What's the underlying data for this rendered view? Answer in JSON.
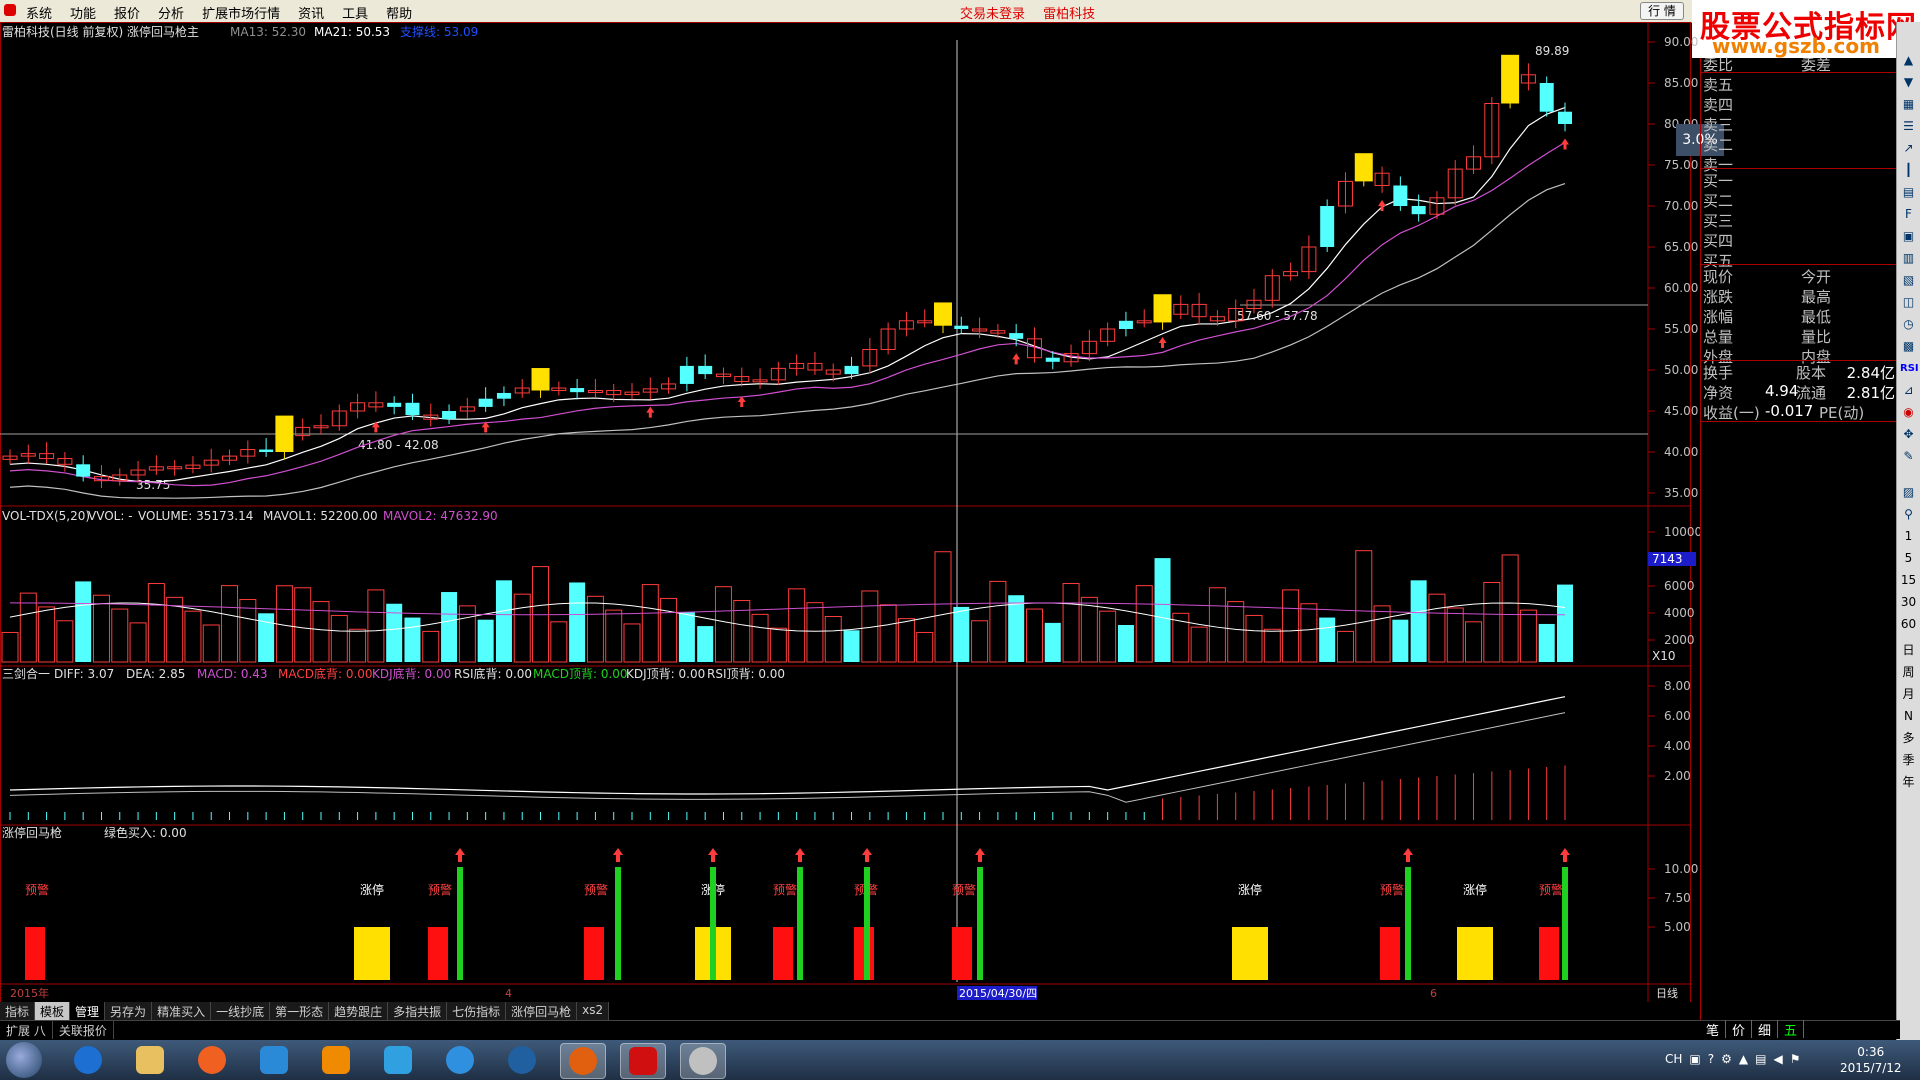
{
  "menubar": {
    "items": [
      "系统",
      "功能",
      "报价",
      "分析",
      "扩展市场行情",
      "资讯",
      "工具",
      "帮助"
    ],
    "status_login": "交易未登录",
    "status_company": "雷柏科技",
    "hangqing": "行 情"
  },
  "watermark": {
    "title": "股票公式指标网",
    "url": "www.gszb.com"
  },
  "main_chart": {
    "title": "雷柏科技(日线 前复权) 涨停回马枪主",
    "ma13": "MA13: 52.30",
    "ma21": "MA21: 50.53",
    "signal": "支撑线: 53.09",
    "high_label": "89.89",
    "low_label": "35.75",
    "range1": "41.80 - 42.08",
    "range2": "57.60 - 57.78",
    "y_ticks": [
      "90.00",
      "85.00",
      "80.00",
      "75.00",
      "70.00",
      "65.00",
      "60.00",
      "55.00",
      "50.00",
      "45.00",
      "40.00",
      "35.00"
    ]
  },
  "vol_panel": {
    "title": "VOL-TDX(5,20)",
    "vvol": "VVOL: -",
    "volume": "VOLUME: 35173.14",
    "mavol1": "MAVOL1: 52200.00",
    "mavol2": "MAVOL2: 47632.90",
    "marker": "7143",
    "unit": "X10",
    "y_ticks": [
      "10000",
      "8000",
      "6000",
      "4000",
      "2000"
    ]
  },
  "macd_panel": {
    "title": "三剑合一",
    "diff": "DIFF: 3.07",
    "dea": "DEA: 2.85",
    "macd": "MACD: 0.43",
    "macd_bottom": "MACD底背: 0.00",
    "kdj_bottom": "KDJ底背: 0.00",
    "rsi_bottom": "RSI底背: 0.00",
    "macd_top": "MACD顶背: 0.00",
    "kdj_top": "KDJ顶背: 0.00",
    "rsi_top": "RSI顶背: 0.00",
    "y_ticks": [
      "8.00",
      "6.00",
      "4.00",
      "2.00"
    ]
  },
  "signal_panel": {
    "title": "涨停回马枪",
    "green_buy": "绿色买入: 0.00",
    "label_warn": "预警",
    "label_limit": "涨停",
    "y_ticks": [
      "10.00",
      "7.50",
      "5.00"
    ]
  },
  "xaxis": {
    "year": "2015年",
    "m4": "4",
    "date": "2015/04/30/四",
    "m6": "6",
    "period": "日线"
  },
  "quote_panel": {
    "sell_rows": [
      {
        "label": "委比",
        "mid": "委差"
      },
      {
        "label": "卖五"
      },
      {
        "label": "卖四"
      },
      {
        "label": "卖三"
      },
      {
        "label": "卖二"
      },
      {
        "label": "卖一"
      }
    ],
    "buy_rows": [
      "买一",
      "买二",
      "买三",
      "买四",
      "买五"
    ],
    "stats": [
      {
        "l": "现价",
        "m": "今开"
      },
      {
        "l": "涨跌",
        "m": "最高"
      },
      {
        "l": "涨幅",
        "m": "最低"
      },
      {
        "l": "总量",
        "m": "量比"
      },
      {
        "l": "外盘",
        "m": "内盘"
      }
    ],
    "fin": [
      {
        "l": "换手",
        "v": "",
        "m": "股本",
        "v2": "2.84亿"
      },
      {
        "l": "净资",
        "v": "4.94",
        "m": "流通",
        "v2": "2.81亿"
      },
      {
        "l": "收益(一)",
        "v": "-0.017",
        "m": "PE(动)",
        "v2": ""
      }
    ],
    "percent": "3.0%"
  },
  "tabs": {
    "row1": [
      "指标",
      "模板",
      "管理",
      "另存为",
      "精准买入",
      "一线抄底",
      "第一形态",
      "趋势跟庄",
      "多指共振",
      "七伤指标",
      "涨停回马枪",
      "xs2"
    ],
    "row2": [
      "扩展 八",
      "关联报价"
    ],
    "right": [
      "笔",
      "价",
      "细"
    ],
    "right_green": "五"
  },
  "right_toolbar": [
    "日",
    "周",
    "月",
    "N",
    "多",
    "季",
    "年"
  ],
  "right_toolbar_nums": [
    "1",
    "5",
    "15",
    "30",
    "60"
  ],
  "right_toolbar_rsi": "RSI",
  "taskbar": {
    "tray_lang": "CH",
    "time": "0:36",
    "date": "2015/7/12"
  },
  "colors": {
    "up": "#ff3c3c",
    "down": "#54ffff",
    "limit": "#ffe000",
    "ma13": "#d050d0",
    "ma21": "#ffffff",
    "signal_green": "#20d020",
    "signal_red": "#ff1010"
  }
}
